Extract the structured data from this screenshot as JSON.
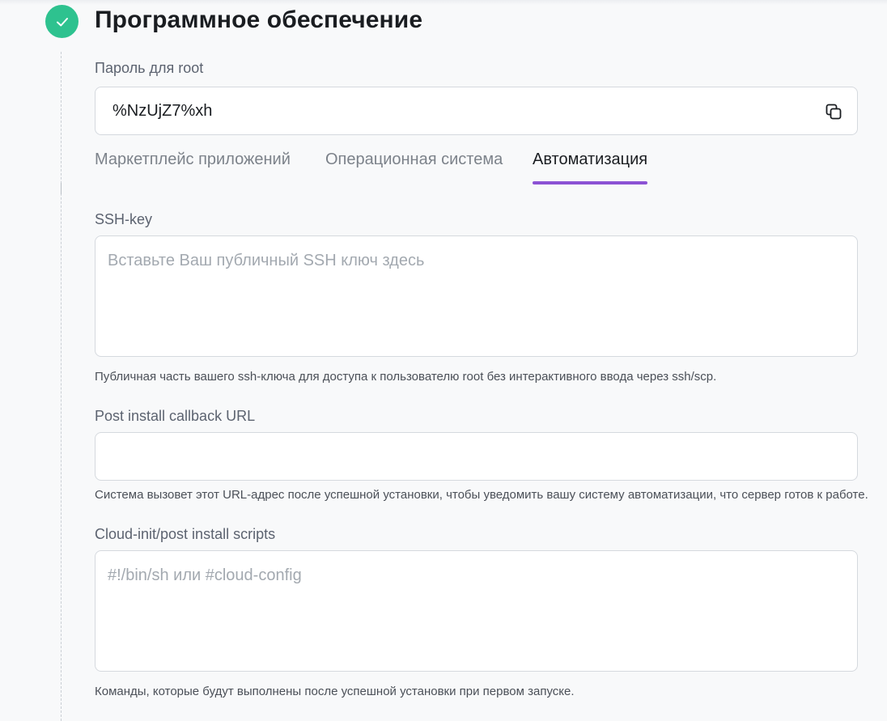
{
  "section": {
    "title": "Программное обеспечение",
    "status_icon": "check-icon",
    "accent_color": "#2ec28f"
  },
  "root_password": {
    "label": "Пароль для root",
    "value": "%NzUjZ7%xh",
    "copy_icon": "copy-icon"
  },
  "tabs": [
    {
      "label": "Маркетплейс приложений",
      "active": false
    },
    {
      "label": "Операционная система",
      "active": false
    },
    {
      "label": "Автоматизация",
      "active": true
    }
  ],
  "tab_accent_color": "#8c52d4",
  "ssh_key": {
    "label": "SSH-key",
    "placeholder": "Вставьте Ваш публичный SSH ключ здесь",
    "value": "",
    "help": "Публичная часть вашего ssh-ключа для доступа к пользователю root без интерактивного ввода через ssh/scp."
  },
  "callback_url": {
    "label": "Post install callback URL",
    "placeholder": "",
    "value": "",
    "help": "Система вызовет этот URL-адрес после успешной установки, чтобы уведомить вашу систему автоматизации, что сервер готов к работе."
  },
  "cloud_init": {
    "label": "Cloud-init/post install scripts",
    "placeholder": "#!/bin/sh или #cloud-config",
    "value": "",
    "help": "Команды, которые будут выполнены после успешной установки при первом запуске."
  }
}
